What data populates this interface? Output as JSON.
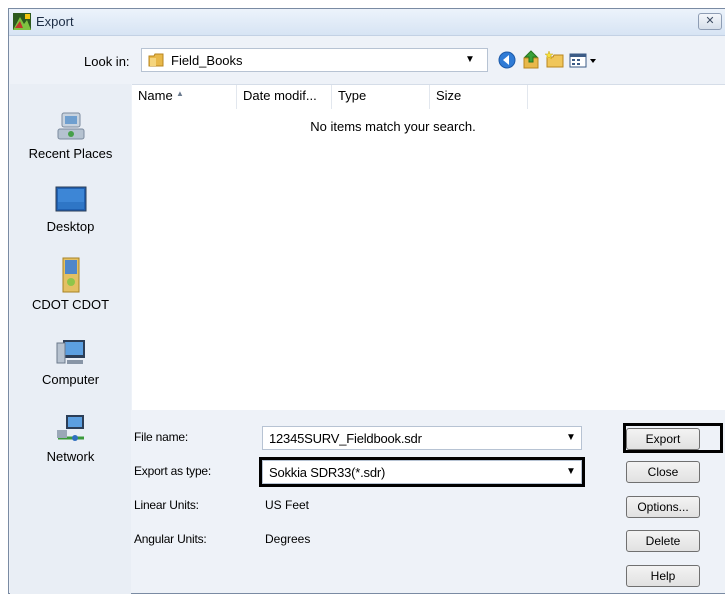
{
  "window": {
    "title": "Export",
    "close_glyph": "✕"
  },
  "lookin": {
    "label": "Look in:",
    "value": "Field_Books"
  },
  "toolbar_icons": [
    "back-icon",
    "up-folder-icon",
    "new-folder-icon",
    "views-menu-icon"
  ],
  "places": [
    {
      "label": "Recent Places",
      "icon": "recent-places-icon"
    },
    {
      "label": "Desktop",
      "icon": "desktop-icon"
    },
    {
      "label": "CDOT CDOT",
      "icon": "user-folder-icon"
    },
    {
      "label": "Computer",
      "icon": "computer-icon"
    },
    {
      "label": "Network",
      "icon": "network-icon"
    }
  ],
  "columns": [
    "Name",
    "Date modif...",
    "Type",
    "Size"
  ],
  "empty_message": "No items match your search.",
  "form": {
    "file_name_label": "File name:",
    "file_name_value": "12345SURV_Fieldbook.sdr",
    "type_label": "Export as type:",
    "type_value": "Sokkia SDR33(*.sdr)",
    "linear_label": "Linear Units:",
    "linear_value": "US Feet",
    "angular_label": "Angular Units:",
    "angular_value": "Degrees"
  },
  "buttons": {
    "export": "Export",
    "close": "Close",
    "options": "Options...",
    "delete": "Delete",
    "help": "Help"
  },
  "colors": {
    "highlight_border": "#000000",
    "panel_bg": "#eef2f8"
  }
}
